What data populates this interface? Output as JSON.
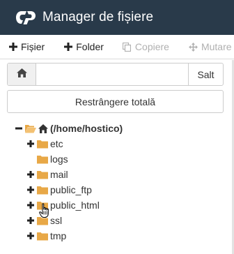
{
  "header": {
    "title": "Manager de fișiere"
  },
  "toolbar": {
    "new_file_label": "Fișier",
    "new_folder_label": "Folder",
    "copy_label": "Copiere",
    "move_label": "Mutare"
  },
  "search": {
    "path_value": "",
    "go_label": "Salt"
  },
  "collapse_all_label": "Restrângere totală",
  "tree": {
    "root_label": "(/home/hostico)",
    "items": [
      {
        "label": "etc",
        "expandable": true
      },
      {
        "label": "logs",
        "expandable": false
      },
      {
        "label": "mail",
        "expandable": true
      },
      {
        "label": "public_ftp",
        "expandable": true
      },
      {
        "label": "public_html",
        "expandable": true
      },
      {
        "label": "ssl",
        "expandable": true
      },
      {
        "label": "tmp",
        "expandable": true
      }
    ]
  },
  "colors": {
    "header_bg": "#293a4a",
    "folder": "#e8a847",
    "disabled_text": "#b0b0b0"
  }
}
